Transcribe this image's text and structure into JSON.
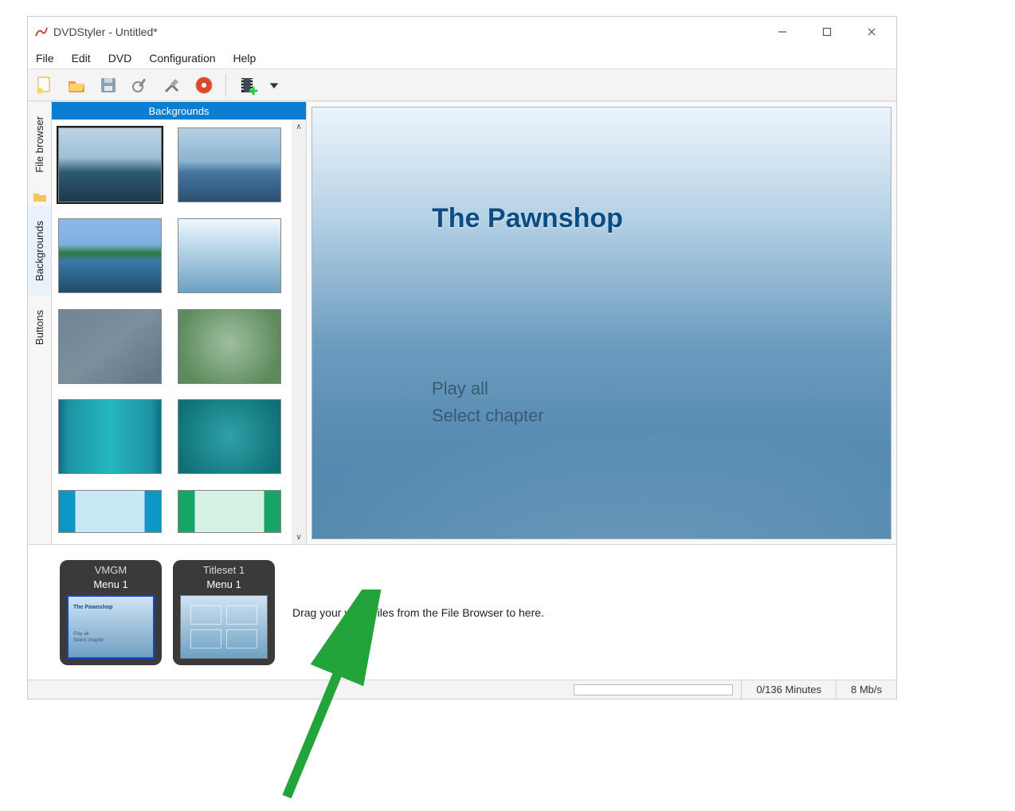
{
  "titlebar": {
    "title": "DVDStyler - Untitled*"
  },
  "menu": {
    "file": "File",
    "edit": "Edit",
    "dvd": "DVD",
    "config": "Configuration",
    "help": "Help"
  },
  "toolbar": {
    "new": "new-file-icon",
    "open": "open-folder-icon",
    "save": "save-icon",
    "settings": "wrench-gear-icon",
    "options": "tools-icon",
    "burn": "burn-disc-icon",
    "addvideo": "add-video-icon"
  },
  "vtabs": {
    "filebrowser": "File browser",
    "backgrounds": "Backgrounds",
    "buttons": "Buttons"
  },
  "palette": {
    "header": "Backgrounds"
  },
  "preview": {
    "title": "The Pawnshop",
    "item1": "Play all",
    "item2": "Select chapter"
  },
  "timeline": {
    "card1_top": "VMGM",
    "card1_menu": "Menu 1",
    "card2_top": "Titleset 1",
    "card2_menu": "Menu 1",
    "hint": "Drag your video files from the File Browser to here."
  },
  "status": {
    "minutes": "0/136 Minutes",
    "bitrate": "8 Mb/s"
  }
}
